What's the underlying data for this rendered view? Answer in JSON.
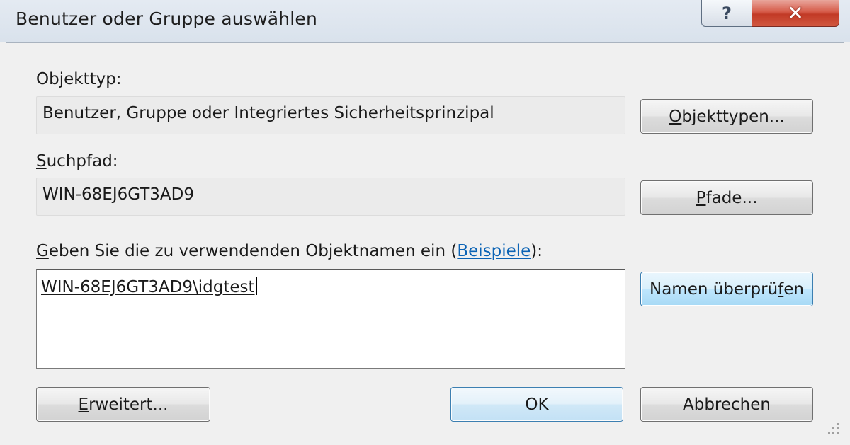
{
  "window": {
    "title": "Benutzer oder Gruppe auswählen",
    "help_glyph": "?",
    "close_glyph": "✕"
  },
  "object_type": {
    "label": "Objekttyp:",
    "value": "Benutzer, Gruppe oder Integriertes Sicherheitsprinzipal",
    "button_prefix": "O",
    "button_rest": "bjekttypen..."
  },
  "search_path": {
    "label_prefix": "S",
    "label_rest": "uchpfad:",
    "value": "WIN-68EJ6GT3AD9",
    "button_prefix": "P",
    "button_rest": "fade..."
  },
  "object_names": {
    "label_prefix": "G",
    "label_mid": "eben Sie die zu verwendenden Objektnamen ein (",
    "link_text": "Beispiele",
    "label_suffix": "):",
    "entered_value": "WIN-68EJ6GT3AD9\\idgtest",
    "check_button_start": "Namen überprü",
    "check_button_key": "f",
    "check_button_end": "en"
  },
  "footer": {
    "advanced_prefix": "E",
    "advanced_rest": "rweitert...",
    "ok_label": "OK",
    "cancel_label": "Abbrechen"
  },
  "colors": {
    "link": "#0b63b5",
    "close_button": "#c23a26",
    "focus_button": "#bee6fd"
  }
}
